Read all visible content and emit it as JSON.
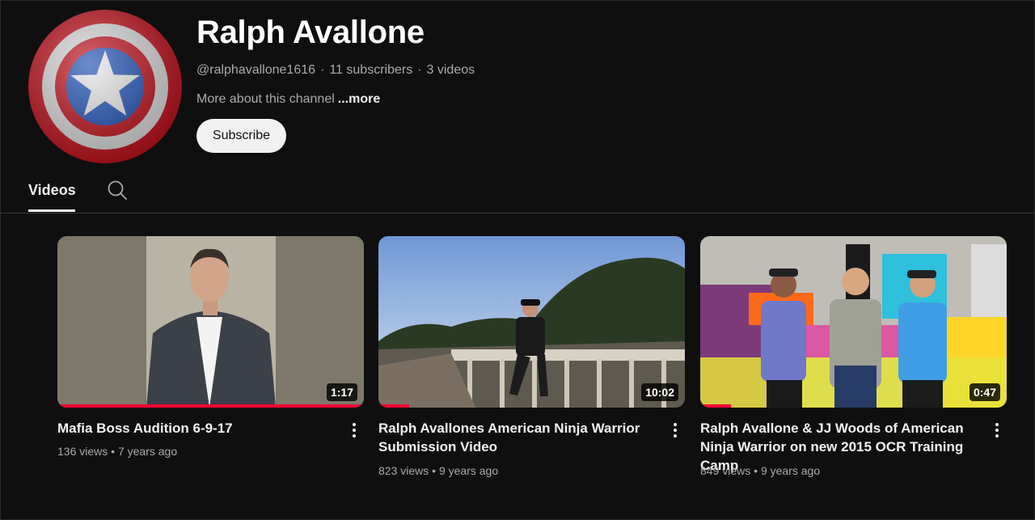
{
  "channel": {
    "name": "Ralph Avallone",
    "handle": "@ralphavallone1616",
    "subscribers": "11 subscribers",
    "video_count": "3 videos",
    "about": "More about this channel",
    "more_link": "...more",
    "subscribe_label": "Subscribe"
  },
  "tabs": [
    {
      "label": "Videos",
      "active": true
    }
  ],
  "videos": [
    {
      "title": "Mafia Boss Audition 6-9-17",
      "views": "136 views",
      "age": "7 years ago",
      "duration": "1:17",
      "watched_fraction": 1.0
    },
    {
      "title": "Ralph Avallones American Ninja Warrior Submission Video",
      "views": "823 views",
      "age": "9 years ago",
      "duration": "10:02",
      "watched_fraction": 0.1
    },
    {
      "title": "Ralph Avallone & JJ Woods of American Ninja Warrior on new 2015 OCR Training Camp",
      "views": "849 views",
      "age": "9 years ago",
      "duration": "0:47",
      "watched_fraction": 0.1
    }
  ],
  "colors": {
    "background": "#0f0f0f",
    "progress": "#ff0033",
    "subscribe_bg": "#f1f1f1"
  }
}
